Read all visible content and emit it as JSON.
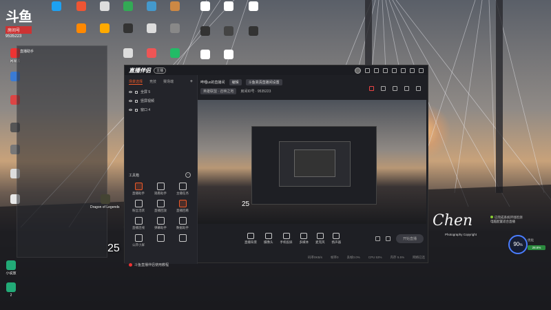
{
  "watermark": {
    "logo": "斗鱼",
    "room_label": "房间号",
    "room_number": "9535223"
  },
  "desktop": {
    "icons_col1": [
      "网易云",
      "",
      "",
      "",
      "",
      "",
      "",
      "",
      ""
    ],
    "icons_col2": [
      "",
      "",
      "",
      "",
      ""
    ],
    "labels": {
      "side_window": "直播助手",
      "app_icon_a": "Dragon of Legends L..."
    },
    "bottom_icons": [
      "小说放",
      "2"
    ]
  },
  "app": {
    "brand": "直播伴侣",
    "brand_tag": "主播",
    "tabs": [
      "场景选择",
      "竞技",
      "赛场端"
    ],
    "tab_plus": "+",
    "scenes": [
      "全屏 5",
      "竖屏视频",
      "窗口 4"
    ],
    "stream_title": "哔哩uo的直播间",
    "stream_tag": "编辑",
    "stream_link": "斗鱼高清直播间设置",
    "stream_sub1": "英雄联盟 · 召唤之地",
    "stream_sub2": "房间ID号 · 9535223",
    "tools_header": "工具箱",
    "tools_more": "···",
    "tools": [
      {
        "label": "直播助手",
        "hot": true
      },
      {
        "label": "观看助手",
        "hot": false
      },
      {
        "label": "主播任务",
        "hot": false
      },
      {
        "label": "粉丝活跃",
        "hot": false
      },
      {
        "label": "直播回放",
        "hot": false
      },
      {
        "label": "直播回看",
        "hot": true
      },
      {
        "label": "直播连线",
        "hot": false
      },
      {
        "label": "弹幕助手",
        "hot": false
      },
      {
        "label": "数据助手",
        "hot": false
      },
      {
        "label": "公开小屏",
        "hot": false
      },
      {
        "label": "",
        "hot": false
      },
      {
        "label": "",
        "hot": false
      }
    ],
    "notice": "斗鱼直播伴侣使用教程",
    "preview_25": "25",
    "bottom_tools": [
      "直播背景",
      "摄像头",
      "手机投屏",
      "多媒体",
      "麦克风",
      "扬声器"
    ],
    "go_live": "开始直播",
    "status": [
      "码率0KB/s",
      "帧率0",
      "丢帧0.0%",
      "CPU 53%",
      "内存 5.5%",
      "网络已连"
    ]
  },
  "overlay": {
    "big25": "25",
    "signature": "Chen",
    "signature_sub": "Photography Copyright",
    "perf_value": "90",
    "perf_unit": "%",
    "perf_sub": "优化",
    "perf_bar": "28.6%",
    "notif_line1": "已完成系统环境检测",
    "notif_line2": "电脑配置适合直播"
  },
  "colors": {
    "accent": "#f05a28",
    "perf": "#4a7dff"
  }
}
